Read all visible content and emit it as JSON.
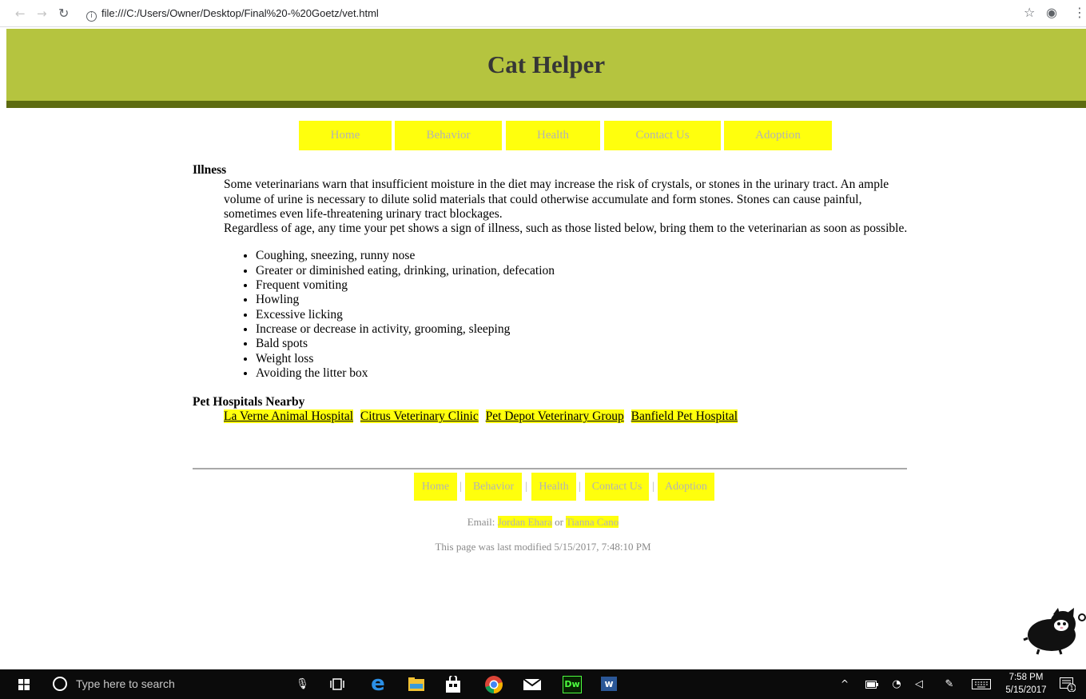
{
  "browser": {
    "url": "file:///C:/Users/Owner/Desktop/Final%20-%20Goetz/vet.html",
    "info_glyph": "i"
  },
  "header": {
    "title": "Cat Helper"
  },
  "topnav": [
    "Home",
    "Behavior",
    "Health",
    "Contact Us",
    "Adoption"
  ],
  "illness": {
    "title": "Illness",
    "para1": "Some veterinarians warn that insufficient moisture in the diet may increase the risk of crystals, or stones in the urinary tract. An ample volume of urine is necessary to dilute solid materials that could otherwise accumulate and form stones. Stones can cause painful, sometimes even life-threatening urinary tract blockages.",
    "para2": "Regardless of age, any time your pet shows a sign of illness, such as those listed below, bring them to the veterinarian as soon as possible.",
    "symptoms": [
      "Coughing, sneezing, runny nose",
      "Greater or diminished eating, drinking, urination, defecation",
      "Frequent vomiting",
      "Howling",
      "Excessive licking",
      "Increase or decrease in activity, grooming, sleeping",
      "Bald spots",
      "Weight loss",
      "Avoiding the litter box"
    ]
  },
  "hospitals": {
    "title": "Pet Hospitals Nearby",
    "links": [
      "La Verne Animal Hospital",
      "Citrus Veterinary Clinic",
      "Pet Depot Veterinary Group",
      "Banfield Pet Hospital"
    ]
  },
  "footer": {
    "nav": [
      "Home",
      "Behavior",
      "Health",
      "Contact Us",
      "Adoption"
    ],
    "separator": "|",
    "email_label": "Email:",
    "email_or": "or",
    "contacts": [
      "Jordan Ehara",
      "Tianna Cano"
    ],
    "modified": "This page was last modified 5/15/2017, 7:48:10 PM"
  },
  "taskbar": {
    "search_placeholder": "Type here to search",
    "time": "7:58 PM",
    "date": "5/15/2017",
    "notification_count": "1",
    "dw_label": "Dw",
    "word_label": "w"
  },
  "colors": {
    "header_bg": "#b5c43f",
    "header_rule": "#5d6b10",
    "nav_bg": "#ffff0d",
    "nav_text": "#b3b3b3"
  }
}
